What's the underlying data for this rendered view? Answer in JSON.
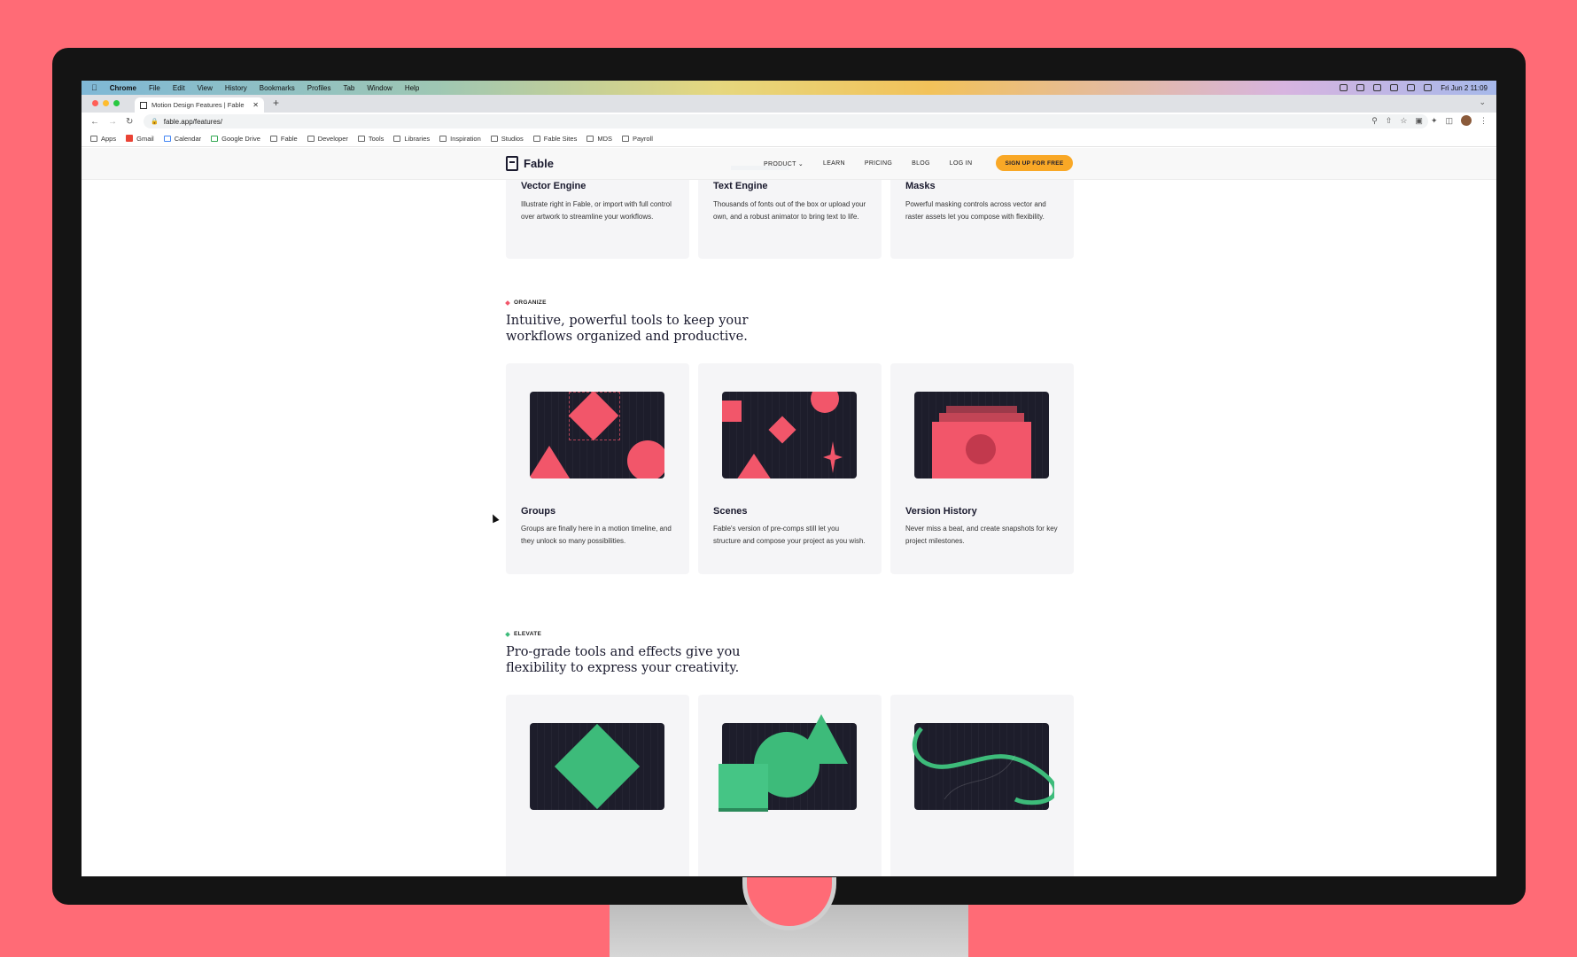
{
  "menubar": {
    "app": "Chrome",
    "items": [
      "File",
      "Edit",
      "View",
      "History",
      "Bookmarks",
      "Profiles",
      "Tab",
      "Window",
      "Help"
    ],
    "clock": "Fri Jun 2  11:09"
  },
  "browser": {
    "tab_title": "Motion Design Features | Fable",
    "url": "fable.app/features/",
    "bookmarks": [
      "Apps",
      "Gmail",
      "Calendar",
      "Google Drive",
      "Fable",
      "Developer",
      "Tools",
      "Libraries",
      "Inspiration",
      "Studios",
      "Fable Sites",
      "MDS",
      "Payroll"
    ]
  },
  "site": {
    "logo": "Fable",
    "nav": [
      "PRODUCT",
      "LEARN",
      "PRICING",
      "BLOG",
      "LOG IN"
    ],
    "cta": "SIGN UP FOR FREE"
  },
  "top_cards": [
    {
      "title": "Vector Engine",
      "text": "Illustrate right in Fable, or import with full control over artwork to streamline your workflows."
    },
    {
      "title": "Text Engine",
      "text": "Thousands of fonts out of the box or upload your own, and a robust animator to bring text to life."
    },
    {
      "title": "Masks",
      "text": "Powerful masking controls across vector and raster assets let you compose with flexibility."
    }
  ],
  "organize": {
    "eyebrow": "ORGANIZE",
    "headline": "Intuitive, powerful tools to keep your workflows organized and productive.",
    "accent": "#f2566a",
    "cards": [
      {
        "title": "Groups",
        "text": "Groups are finally here in a motion timeline, and they unlock so many possibilities."
      },
      {
        "title": "Scenes",
        "text": "Fable's version of pre-comps still let you structure and compose your project as you wish."
      },
      {
        "title": "Version History",
        "text": "Never miss a beat, and create snapshots for key project milestones."
      }
    ]
  },
  "elevate": {
    "eyebrow": "ELEVATE",
    "headline": "Pro-grade tools and effects give you flexibility to express your creativity.",
    "accent": "#3dbb7a"
  }
}
